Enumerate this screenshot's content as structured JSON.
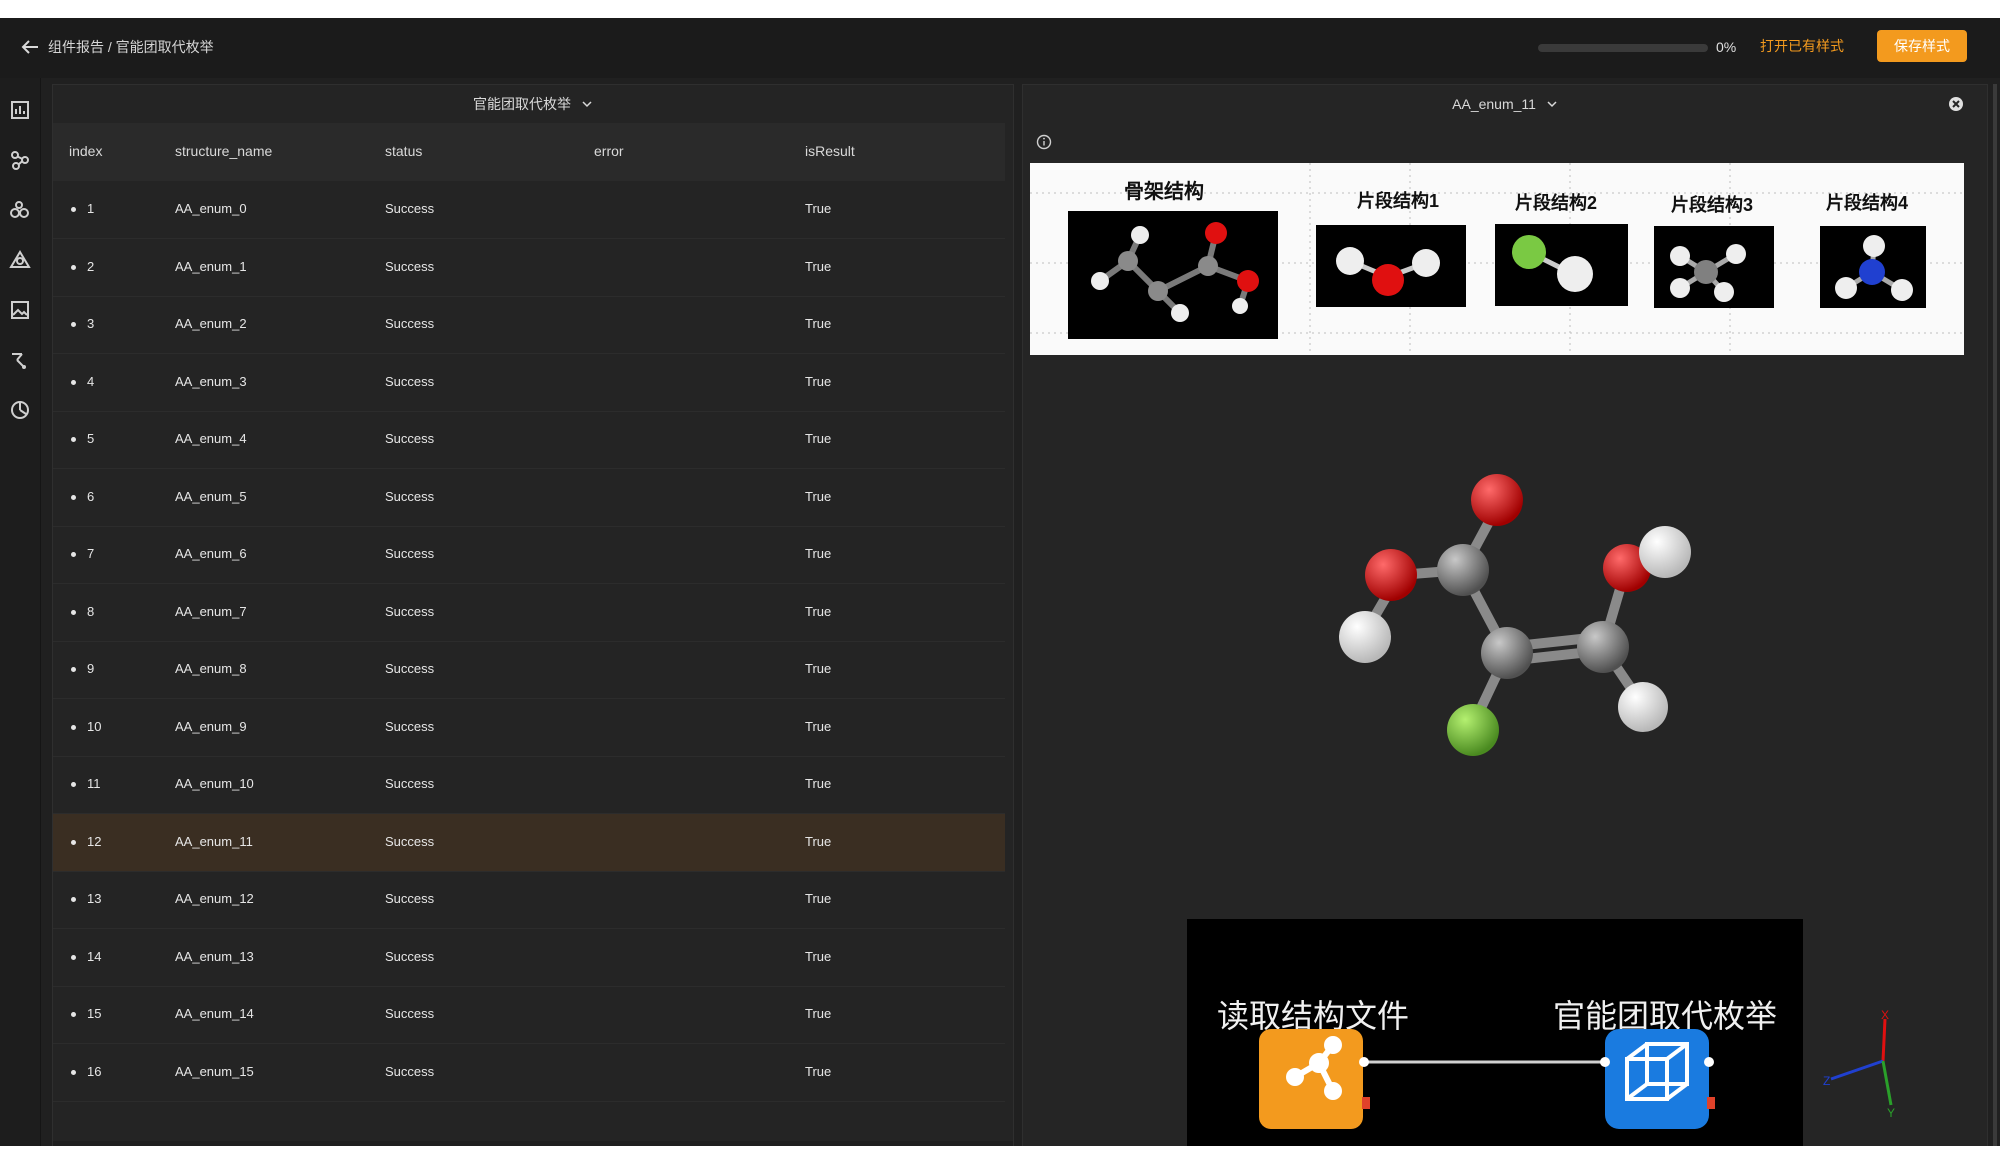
{
  "topbar": {
    "breadcrumb": "组件报告 / 官能团取代枚举",
    "progress_percent": 0,
    "progress_text": "0%",
    "open_style_label": "打开已有样式",
    "save_style_label": "保存样式",
    "accent_color": "#f39a1e"
  },
  "rail": {
    "icons": [
      "chart-icon",
      "molecule-icon",
      "atoms-icon",
      "triangle-network-icon",
      "image-icon",
      "path-icon",
      "pie-icon"
    ]
  },
  "left_panel": {
    "title": "官能团取代枚举",
    "columns": [
      "index",
      "structure_name",
      "status",
      "error",
      "isResult"
    ],
    "selected_index": 12,
    "rows": [
      {
        "index": "1",
        "structure_name": "AA_enum_0",
        "status": "Success",
        "error": "",
        "isResult": "True"
      },
      {
        "index": "2",
        "structure_name": "AA_enum_1",
        "status": "Success",
        "error": "",
        "isResult": "True"
      },
      {
        "index": "3",
        "structure_name": "AA_enum_2",
        "status": "Success",
        "error": "",
        "isResult": "True"
      },
      {
        "index": "4",
        "structure_name": "AA_enum_3",
        "status": "Success",
        "error": "",
        "isResult": "True"
      },
      {
        "index": "5",
        "structure_name": "AA_enum_4",
        "status": "Success",
        "error": "",
        "isResult": "True"
      },
      {
        "index": "6",
        "structure_name": "AA_enum_5",
        "status": "Success",
        "error": "",
        "isResult": "True"
      },
      {
        "index": "7",
        "structure_name": "AA_enum_6",
        "status": "Success",
        "error": "",
        "isResult": "True"
      },
      {
        "index": "8",
        "structure_name": "AA_enum_7",
        "status": "Success",
        "error": "",
        "isResult": "True"
      },
      {
        "index": "9",
        "structure_name": "AA_enum_8",
        "status": "Success",
        "error": "",
        "isResult": "True"
      },
      {
        "index": "10",
        "structure_name": "AA_enum_9",
        "status": "Success",
        "error": "",
        "isResult": "True"
      },
      {
        "index": "11",
        "structure_name": "AA_enum_10",
        "status": "Success",
        "error": "",
        "isResult": "True"
      },
      {
        "index": "12",
        "structure_name": "AA_enum_11",
        "status": "Success",
        "error": "",
        "isResult": "True"
      },
      {
        "index": "13",
        "structure_name": "AA_enum_12",
        "status": "Success",
        "error": "",
        "isResult": "True"
      },
      {
        "index": "14",
        "structure_name": "AA_enum_13",
        "status": "Success",
        "error": "",
        "isResult": "True"
      },
      {
        "index": "15",
        "structure_name": "AA_enum_14",
        "status": "Success",
        "error": "",
        "isResult": "True"
      },
      {
        "index": "16",
        "structure_name": "AA_enum_15",
        "status": "Success",
        "error": "",
        "isResult": "True"
      }
    ]
  },
  "right_panel": {
    "title": "AA_enum_11",
    "fragments": [
      {
        "label": "骨架结构"
      },
      {
        "label": "片段结构1"
      },
      {
        "label": "片段结构2"
      },
      {
        "label": "片段结构3"
      },
      {
        "label": "片段结构4"
      }
    ],
    "atom_colors": {
      "carbon": "#808080",
      "oxygen": "#e01010",
      "hydrogen": "#f2f2f2",
      "fluorine": "#7ac943",
      "nitrogen": "#2040d0"
    },
    "workflow": {
      "node1_label": "读取结构文件",
      "node2_label": "官能团取代枚举",
      "node1_color": "#f39a1e",
      "node2_color": "#1a7be0"
    },
    "axes": {
      "x": "X",
      "y": "Y",
      "z": "Z"
    }
  }
}
